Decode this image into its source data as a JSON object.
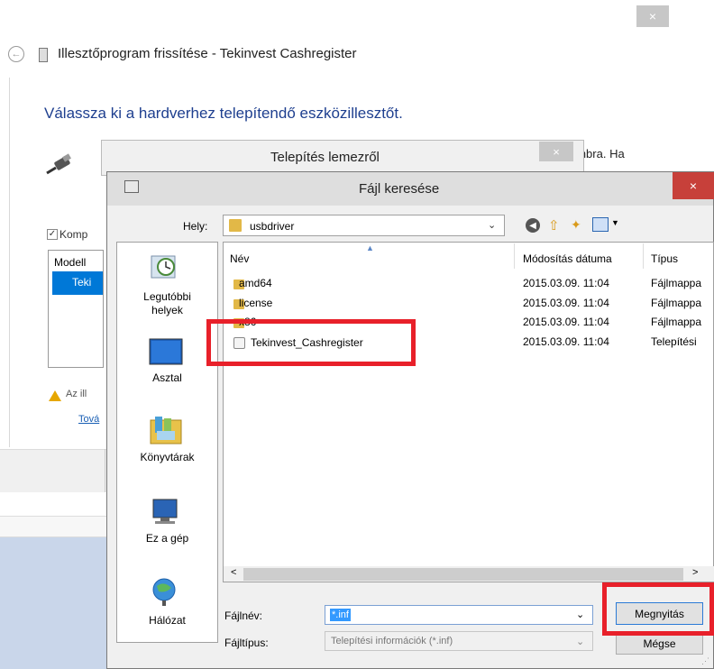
{
  "background_window": {
    "close_glyph": "×",
    "back_glyph": "←",
    "title": "Illesztőprogram frissítése - Tekinvest Cashregister",
    "heading": "Válassza ki a hardverhez telepítendő eszközillesztőt.",
    "partial_text": "ombra. Ha",
    "compat_checkbox_label": "Komp",
    "list_header": "Modell",
    "list_selected": "Teki",
    "warning_text": "Az ill",
    "link_text": "Tová"
  },
  "disk_dialog": {
    "title": "Telepítés lemezről",
    "close_glyph": "×"
  },
  "file_dialog": {
    "title": "Fájl keresése",
    "close_glyph": "×",
    "location_label": "Hely:",
    "location_value": "usbdriver",
    "places": [
      {
        "label_line1": "Legutóbbi",
        "label_line2": "helyek",
        "icon": "recent-places-icon"
      },
      {
        "label_line1": "Asztal",
        "label_line2": "",
        "icon": "desktop-icon"
      },
      {
        "label_line1": "Könyvtárak",
        "label_line2": "",
        "icon": "libraries-icon"
      },
      {
        "label_line1": "Ez a gép",
        "label_line2": "",
        "icon": "computer-icon"
      },
      {
        "label_line1": "Hálózat",
        "label_line2": "",
        "icon": "network-icon"
      }
    ],
    "columns": {
      "name": "Név",
      "date": "Módosítás dátuma",
      "type": "Típus"
    },
    "rows": [
      {
        "name": "amd64",
        "date": "2015.03.09. 11:04",
        "type": "Fájlmappa"
      },
      {
        "name": "license",
        "date": "2015.03.09. 11:04",
        "type": "Fájlmappa"
      },
      {
        "name": "x86",
        "date": "2015.03.09. 11:04",
        "type": "Fájlmappa"
      },
      {
        "name": "Tekinvest_Cashregister",
        "date": "2015.03.09. 11:04",
        "type": "Telepítési"
      }
    ],
    "filename_label": "Fájlnév:",
    "filename_value": "*.inf",
    "filetype_label": "Fájltípus:",
    "filetype_value": "Telepítési információk (*.inf)",
    "open_button": "Megnyitás",
    "cancel_button": "Mégse",
    "scroll_left": "<",
    "scroll_right": ">",
    "dropdown_glyph": "⌄"
  },
  "colors": {
    "highlight": "#e8202a",
    "accent": "#0078d7",
    "heading": "#1e3f8f"
  }
}
